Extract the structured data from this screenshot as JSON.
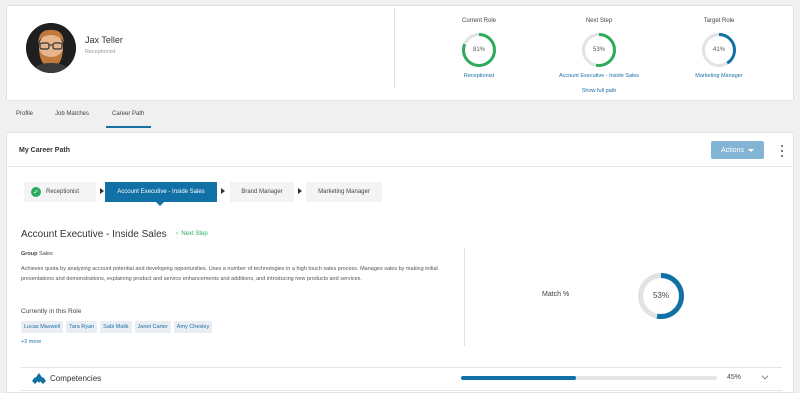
{
  "profile": {
    "name": "Jax Teller",
    "role": "Receptionist",
    "show_full_path": "Show full path",
    "rings": [
      {
        "label": "Current Role",
        "pct": 81,
        "pct_text": "81%",
        "link": "Receptionist",
        "color": "#2eaa5c"
      },
      {
        "label": "Next Step",
        "pct": 53,
        "pct_text": "53%",
        "link": "Account Executive - Inside Sales",
        "color": "#2eaa5c"
      },
      {
        "label": "Target Role",
        "pct": 41,
        "pct_text": "41%",
        "link": "Marketing Manager",
        "color": "#1170a6"
      }
    ]
  },
  "tabs": [
    "Profile",
    "Job Matches",
    "Career Path"
  ],
  "active_tab": "Career Path",
  "career": {
    "title": "My Career Path",
    "actions_label": "Actions",
    "steps": [
      {
        "label": "Receptionist",
        "state": "completed"
      },
      {
        "label": "Account Executive - Inside Sales",
        "state": "active"
      },
      {
        "label": "Brand Manager",
        "state": "upcoming"
      },
      {
        "label": "Marketing Manager",
        "state": "upcoming"
      }
    ]
  },
  "role_detail": {
    "title": "Account Executive - Inside Sales",
    "next_step": "Next Step",
    "group_label": "Group",
    "group_value": "Sales",
    "description": "Achieves quota by analyzing account potential and developing opportunities. Uses a number of technologies in a high touch sales process. Manages sales by making initial presentations and demonstrations, explaining product and service enhancements and additions, and introducing new products and services.",
    "currently_in_role": "Currently in this Role",
    "people": [
      "Lucas Maxwell",
      "Tara Ryan",
      "Sabi Malik",
      "Janet Carter",
      "Amy Chesley"
    ],
    "more": "+2 more",
    "match_label": "Match %",
    "match_pct": 53,
    "match_text": "53%"
  },
  "competencies": {
    "label": "Competencies",
    "pct": 45,
    "pct_text": "45%"
  },
  "colors": {
    "accent": "#1170a6",
    "success": "#2eaa5c",
    "actions_button": "#84b4d4"
  }
}
